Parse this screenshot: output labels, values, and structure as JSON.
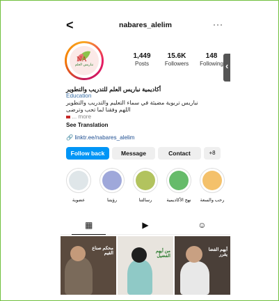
{
  "header": {
    "back": "<",
    "username": "nabares_alelim",
    "more": "···"
  },
  "profile": {
    "logo_text": "نباريس العلم",
    "stats": [
      {
        "value": "1,449",
        "label": "Posts"
      },
      {
        "value": "15.6K",
        "label": "Followers"
      },
      {
        "value": "148",
        "label": "Following"
      }
    ],
    "side_tab": "‹"
  },
  "bio": {
    "name": "أكاديمية نباريس العلم للتدريب والتطوير",
    "category": "Education",
    "line1": "نباريس تربوية مضيئة في سماء التعليم والتدريب والتطوير",
    "line2": "اللهم وفقنا لما تحب وترضى",
    "more": "... more",
    "see_translation": "See Translation",
    "link": "linktr.ee/nabares_alelim"
  },
  "buttons": {
    "follow_back": "Follow back",
    "message": "Message",
    "contact": "Contact",
    "add_person": "+8"
  },
  "highlights": [
    {
      "label": "عضوية",
      "color": "#dfe6e9"
    },
    {
      "label": "رؤيتنا",
      "color": "#9fa8da"
    },
    {
      "label": "رسالتنا",
      "color": "#b2c35e"
    },
    {
      "label": "نهج الأكاديمية",
      "color": "#66bb6a"
    },
    {
      "label": "رحب والسعة",
      "color": "#f4c16b"
    }
  ],
  "tabs": {
    "grid": "▦",
    "reels": "▶",
    "tagged": "☺"
  },
  "grid": [
    {
      "caption": "محكم صناع القيم"
    },
    {
      "caption": "من أيهم الفضيل"
    },
    {
      "caption": "أيهم الفضا يقرر"
    }
  ],
  "colors": {
    "accent": "#0095f6",
    "link": "#1e4e91",
    "border": "#6fbf3c"
  }
}
